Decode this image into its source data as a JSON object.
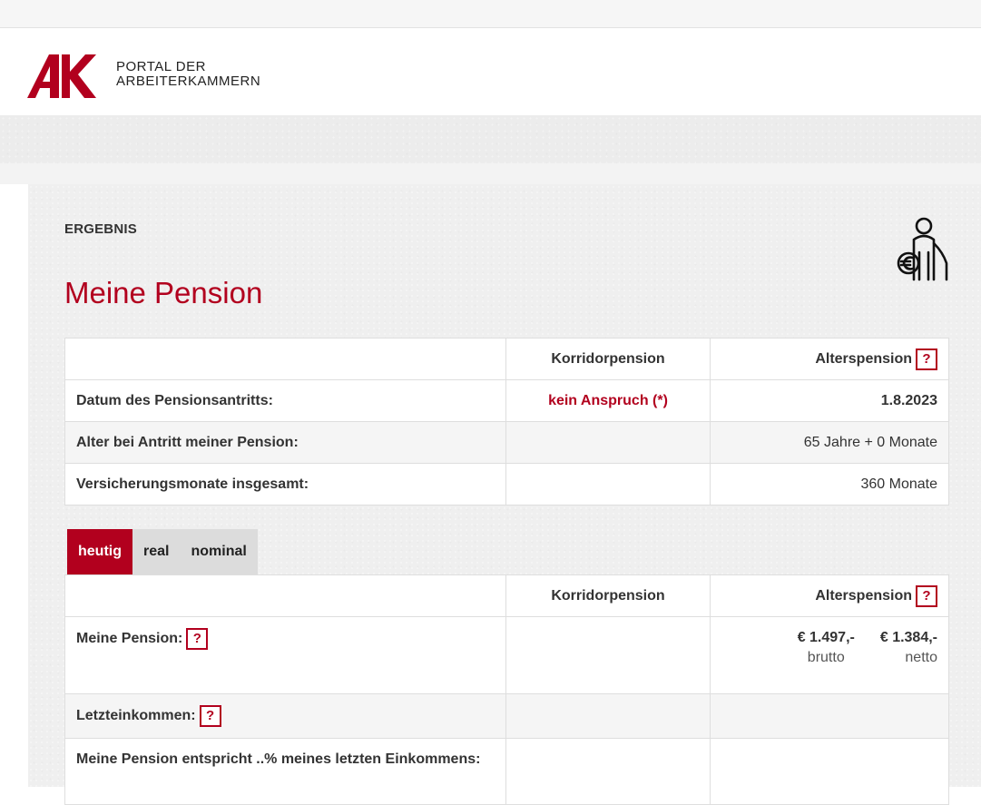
{
  "brand": {
    "logo_letters": "AK",
    "line1": "PORTAL DER",
    "line2": "ARBEITERKAMMERN",
    "accent": "#b2001e"
  },
  "result": {
    "eyebrow": "ERGEBNIS",
    "title": "Meine Pension",
    "icon": "pensioner-euro-icon"
  },
  "summary_table": {
    "headers": [
      "",
      "Korridorpension",
      "Alterspension"
    ],
    "help_label": "?",
    "rows": [
      {
        "label": "Datum des Pensionsantritts:",
        "korridor": "kein Anspruch (*)",
        "alters": "1.8.2023"
      },
      {
        "label": "Alter bei Antritt meiner Pension:",
        "korridor": "",
        "alters": "65 Jahre + 0 Monate"
      },
      {
        "label": "Versicherungsmonate insgesamt:",
        "korridor": "",
        "alters": "360 Monate"
      }
    ]
  },
  "tabs": [
    {
      "label": "heutig",
      "active": true
    },
    {
      "label": "real",
      "active": false
    },
    {
      "label": "nominal",
      "active": false
    }
  ],
  "amount_table": {
    "headers": [
      "",
      "Korridorpension",
      "Alterspension"
    ],
    "help_label": "?",
    "rows": [
      {
        "label": "Meine Pension:",
        "korridor": "",
        "brutto_value": "€ 1.497,-",
        "brutto_label": "brutto",
        "netto_value": "€ 1.384,-",
        "netto_label": "netto"
      },
      {
        "label": "Letzteinkommen:",
        "korridor": "",
        "alters": ""
      },
      {
        "label": "Meine Pension entspricht ..% meines letzten Einkommens:",
        "korridor": "",
        "alters": ""
      }
    ]
  }
}
